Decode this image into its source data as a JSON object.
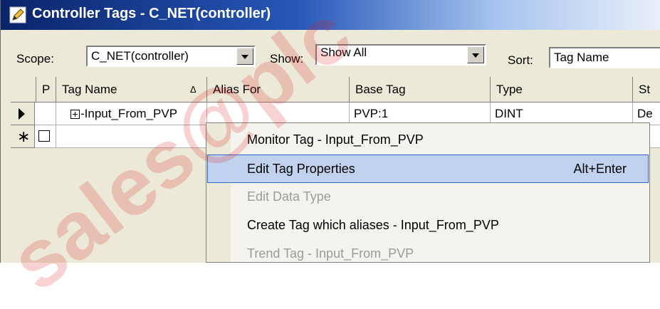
{
  "window": {
    "title": "Controller Tags - C_NET(controller)"
  },
  "toolbar": {
    "scope_label": "Scope:",
    "scope_value": "C_NET(controller)",
    "show_label": "Show:",
    "show_value": "Show All",
    "sort_label": "Sort:",
    "sort_value": "Tag Name"
  },
  "table": {
    "headers": [
      "P",
      "Tag Name",
      "Alias For",
      "Base Tag",
      "Type",
      "St"
    ],
    "sort_indicator": "Δ",
    "row1": {
      "tag": "Input_From_PVP",
      "alias": "",
      "base": "PVP:1",
      "type": "DINT",
      "style": "De"
    }
  },
  "context_menu": {
    "items": [
      {
        "label": "Monitor Tag - Input_From_PVP",
        "shortcut": "",
        "state": "normal"
      },
      {
        "label": "Edit Tag Properties",
        "shortcut": "Alt+Enter",
        "state": "highlighted"
      },
      {
        "label": "Edit Data Type",
        "shortcut": "",
        "state": "disabled"
      },
      {
        "label": "Create Tag which aliases - Input_From_PVP",
        "shortcut": "",
        "state": "normal"
      },
      {
        "label": "Trend Tag - Input_From_PVP",
        "shortcut": "",
        "state": "disabled"
      }
    ]
  },
  "watermark": "sales@plc",
  "colors": {
    "title_bar": "#0a246a",
    "menu_highlight": "#c1d2ee",
    "watermark": "#dc1e1e"
  }
}
